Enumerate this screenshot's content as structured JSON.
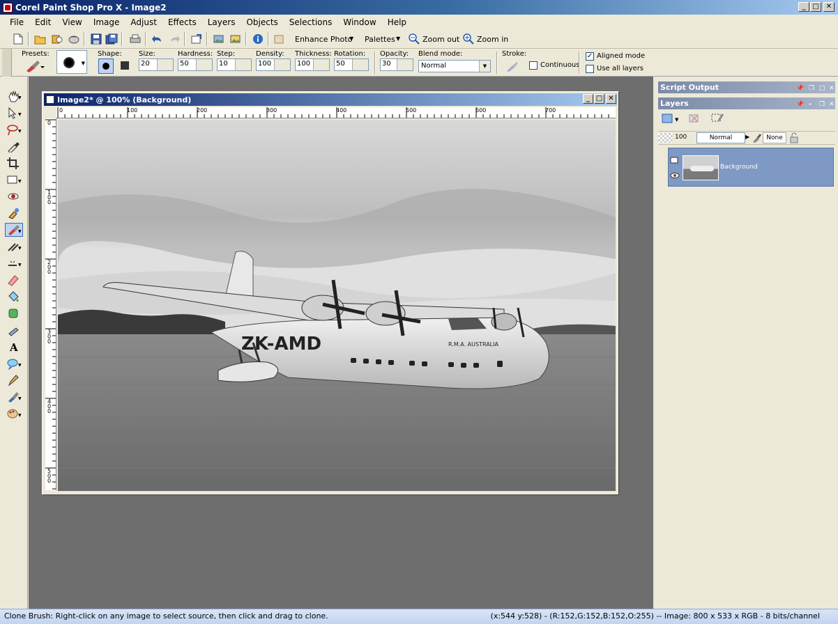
{
  "app": {
    "title": "Corel Paint Shop Pro X - Image2"
  },
  "menu": [
    "File",
    "Edit",
    "View",
    "Image",
    "Adjust",
    "Effects",
    "Layers",
    "Objects",
    "Selections",
    "Window",
    "Help"
  ],
  "toolbar": {
    "enhance_photo": "Enhance Photo",
    "palettes": "Palettes",
    "zoom_out": "Zoom out",
    "zoom_in": "Zoom in"
  },
  "tool_options": {
    "presets_label": "Presets:",
    "shape_label": "Shape:",
    "size_label": "Size:",
    "size_value": "20",
    "hardness_label": "Hardness:",
    "hardness_value": "50",
    "step_label": "Step:",
    "step_value": "10",
    "density_label": "Density:",
    "density_value": "100",
    "thickness_label": "Thickness:",
    "thickness_value": "100",
    "rotation_label": "Rotation:",
    "rotation_value": "50",
    "opacity_label": "Opacity:",
    "opacity_value": "30",
    "blend_label": "Blend mode:",
    "blend_value": "Normal",
    "stroke_label": "Stroke:",
    "continuous_label": "Continuous",
    "continuous_checked": false,
    "aligned_label": "Aligned mode",
    "aligned_checked": true,
    "use_all_layers_label": "Use all layers",
    "use_all_layers_checked": false
  },
  "document": {
    "title": "Image2* @ 100% (Background)",
    "hruler": [
      "0",
      "100",
      "200",
      "300",
      "400",
      "500",
      "600",
      "700"
    ],
    "vruler": [
      "0",
      "100",
      "200",
      "300",
      "400",
      "500"
    ],
    "aircraft_registration": "ZK-AMD",
    "aircraft_markings": "R.M.A. AUSTRALIA"
  },
  "palettes": {
    "script_output_title": "Script Output",
    "layers_title": "Layers",
    "layer_opacity": "100",
    "layer_blend": "Normal",
    "layer_mask_mode": "None",
    "layers": [
      {
        "name": "Background",
        "selected": true
      }
    ]
  },
  "status": {
    "hint": "Clone Brush: Right-click on any image to select source, then click and drag to clone.",
    "info": "(x:544 y:528) - (R:152,G:152,B:152,O:255) -- Image:  800 x 533 x RGB - 8 bits/channel"
  },
  "colors": {
    "title_active": "#0a246a",
    "layer_selected": "#7e99c4",
    "workspace": "#6e6e6e"
  }
}
